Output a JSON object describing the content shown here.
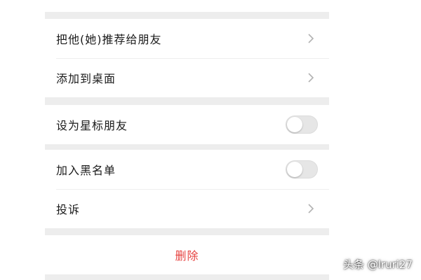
{
  "settings": {
    "recommend_label": "把他(她)推荐给朋友",
    "add_to_desktop_label": "添加到桌面",
    "star_friend_label": "设为星标朋友",
    "star_friend_on": false,
    "blacklist_label": "加入黑名单",
    "blacklist_on": false,
    "complain_label": "投诉",
    "delete_label": "删除"
  },
  "watermark": {
    "text": "头条 @lruri27"
  },
  "colors": {
    "background": "#ededed",
    "card": "#ffffff",
    "text": "#1a1a1a",
    "chevron": "#b2b2b2",
    "toggle_off": "#e6e6e6",
    "delete": "#e64340"
  },
  "icons": {
    "chevron": "chevron-right-icon"
  }
}
